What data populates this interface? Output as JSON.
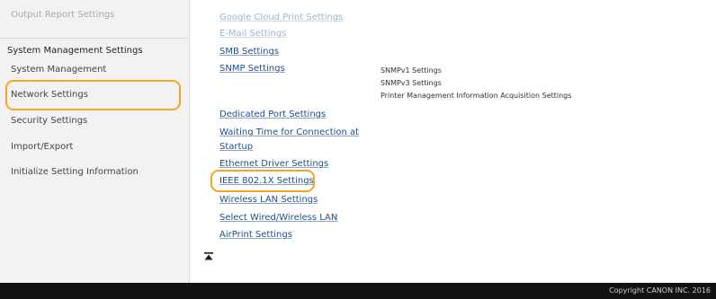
{
  "sidebar": {
    "items": [
      {
        "label": "Output Report Settings"
      },
      {
        "label": "System Management Settings"
      },
      {
        "label": "System Management"
      },
      {
        "label": "Network Settings"
      },
      {
        "label": "Security Settings"
      },
      {
        "label": "Import/Export"
      },
      {
        "label": "Initialize Setting Information"
      }
    ]
  },
  "main": {
    "links": [
      "Google Cloud Print Settings",
      "E-Mail Settings",
      "SMB Settings",
      "SNMP Settings",
      "Dedicated Port Settings",
      "Waiting Time for Connection at",
      "Startup",
      "Ethernet Driver Settings",
      "IEEE 802.1X Settings",
      "Wireless LAN Settings",
      "Select Wired/Wireless LAN",
      "AirPrint Settings"
    ],
    "snmp_sub": [
      "SNMPv1 Settings",
      "SNMPv3 Settings",
      "Printer Management Information Acquisition Settings"
    ]
  },
  "footer": {
    "copyright": "Copyright CANON INC. 2016"
  },
  "colors": {
    "highlight": "#f5a623",
    "link": "#1f4e8c",
    "footer_bg": "#121212"
  }
}
